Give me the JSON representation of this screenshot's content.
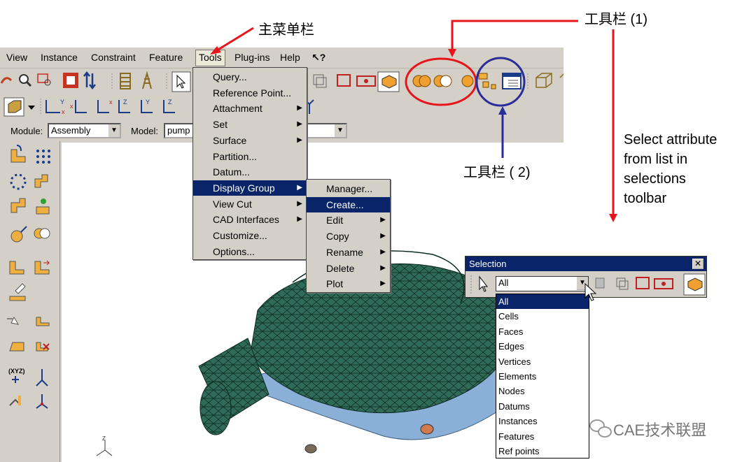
{
  "annotations": {
    "main_menu_bar": "主菜单栏",
    "toolbar_1": "工具栏  (1)",
    "toolbar_2": "工具栏 ( 2)",
    "select_note_lines": [
      "Select attribute",
      "from list in",
      "selections",
      "toolbar"
    ]
  },
  "menubar": [
    "View",
    "Instance",
    "Constraint",
    "Feature",
    "Tools",
    "Plug-ins",
    "Help",
    "↖?"
  ],
  "context_bar": {
    "module_label": "Module:",
    "module_value": "Assembly",
    "model_label": "Model:",
    "model_value": "pump"
  },
  "tools_menu": [
    {
      "label": "Query...",
      "submenu": false
    },
    {
      "label": "Reference Point...",
      "submenu": false
    },
    {
      "label": "Attachment",
      "submenu": true
    },
    {
      "label": "Set",
      "submenu": true
    },
    {
      "label": "Surface",
      "submenu": true
    },
    {
      "label": "Partition...",
      "submenu": false
    },
    {
      "label": "Datum...",
      "submenu": false
    },
    {
      "label": "Display Group",
      "submenu": true
    },
    {
      "label": "View Cut",
      "submenu": true
    },
    {
      "label": "CAD Interfaces",
      "submenu": true
    },
    {
      "label": "Customize...",
      "submenu": false
    },
    {
      "label": "Options...",
      "submenu": false
    }
  ],
  "display_group_menu": [
    {
      "label": "Manager...",
      "submenu": false
    },
    {
      "label": "Create...",
      "submenu": false
    },
    {
      "label": "Edit",
      "submenu": true
    },
    {
      "label": "Copy",
      "submenu": true
    },
    {
      "label": "Rename",
      "submenu": true
    },
    {
      "label": "Delete",
      "submenu": true
    },
    {
      "label": "Plot",
      "submenu": true
    }
  ],
  "selection_window": {
    "title": "Selection",
    "close": "✕",
    "combo_value": "All",
    "options": [
      "All",
      "Cells",
      "Faces",
      "Edges",
      "Vertices",
      "Elements",
      "Nodes",
      "Datums",
      "Instances",
      "Features",
      "Ref points"
    ]
  },
  "watermark": "CAE技术联盟",
  "axis_label": "Z",
  "colors": {
    "highlight": "#0a246a",
    "red": "#e8141b",
    "blue": "#2b2b9a",
    "mesh": "#2f6b58",
    "panel": "#d4d0c8"
  }
}
